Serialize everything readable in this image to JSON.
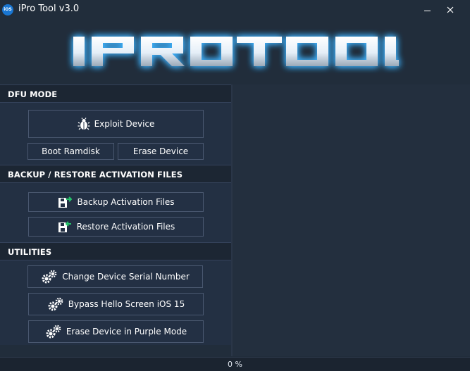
{
  "window": {
    "app_icon_text": "iOS",
    "title": "iPro Tool v3.0",
    "minimize_symbol": "–",
    "close_symbol": "✕"
  },
  "banner": {
    "logo_text": "IPRO TOOL",
    "glow_color": "#3fb3ff"
  },
  "sections": {
    "dfu": {
      "title": "DFU MODE",
      "exploit_label": "Exploit Device",
      "boot_ramdisk_label": "Boot Ramdisk",
      "erase_label": "Erase Device"
    },
    "backup": {
      "title": "BACKUP / RESTORE ACTIVATION FILES",
      "backup_label": "Backup Activation Files",
      "restore_label": "Restore Activation Files"
    },
    "utilities": {
      "title": "UTILITIES",
      "serial_label": "Change Device Serial Number",
      "hello_label": "Bypass Hello Screen iOS 15",
      "purple_label": "Erase Device in Purple Mode"
    }
  },
  "status": {
    "progress_text": "0 %",
    "progress": 0
  },
  "colors": {
    "background": "#212d3b",
    "section_header": "#1c2633",
    "button_border": "#4a5870",
    "arrow_green": "#27c46b"
  }
}
